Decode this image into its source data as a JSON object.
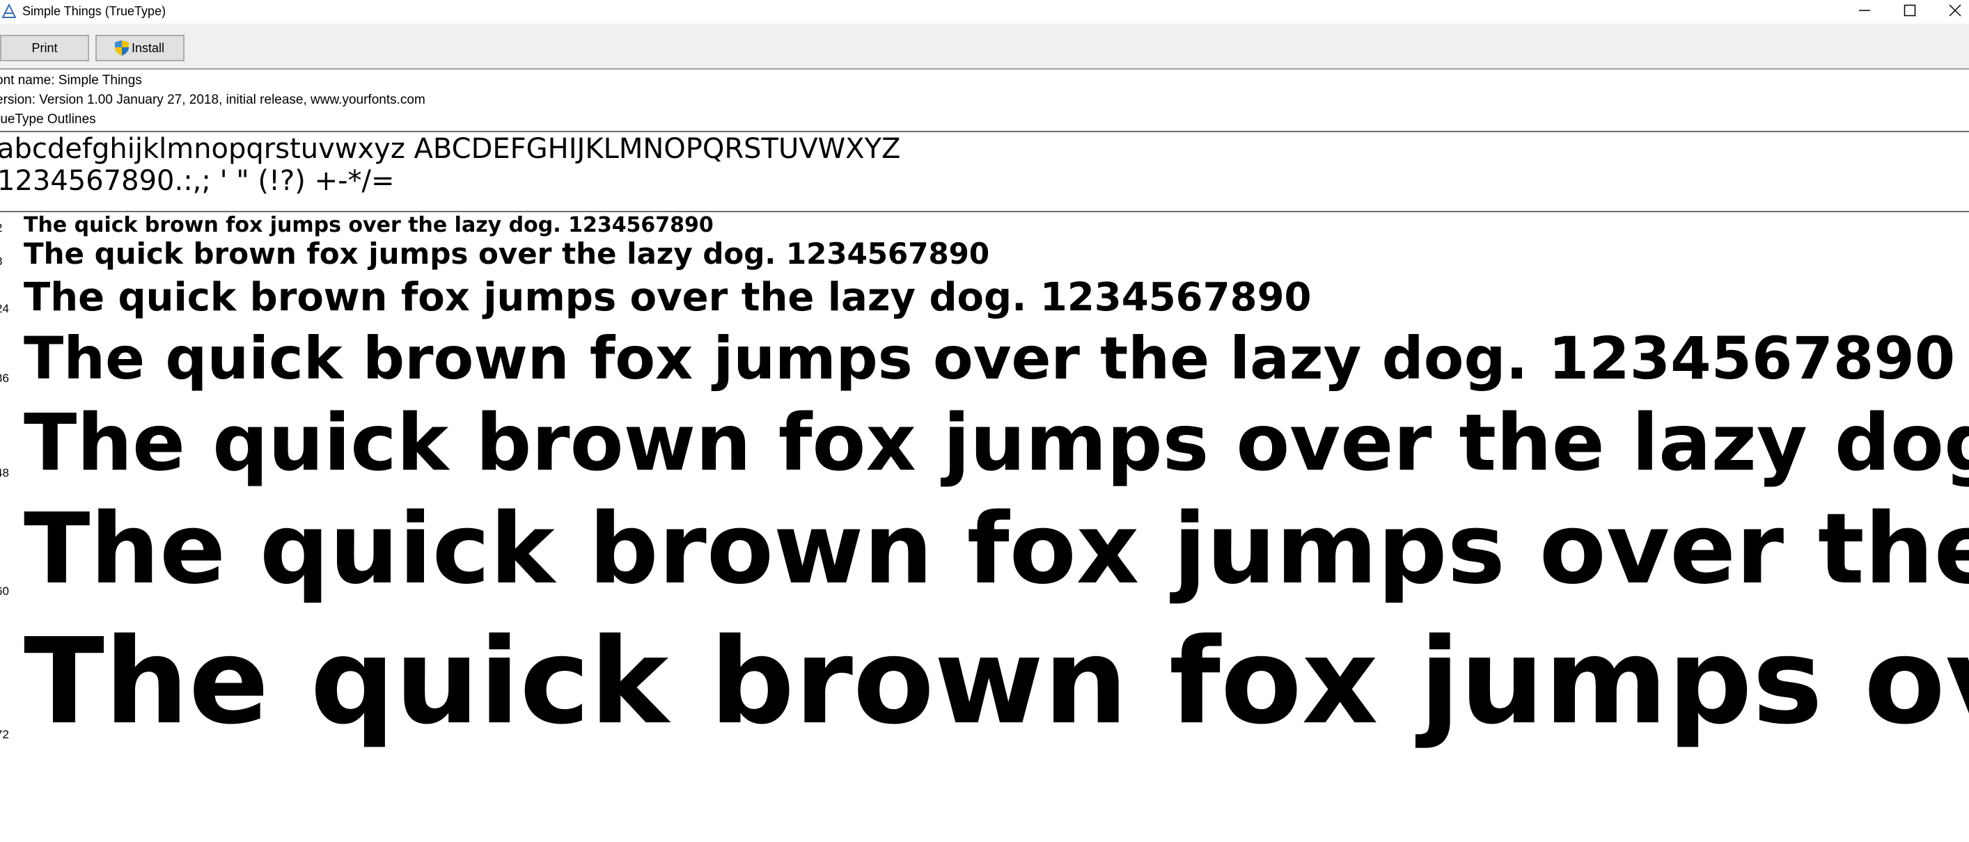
{
  "window": {
    "title": "Simple Things (TrueType)"
  },
  "toolbar": {
    "print_label": "Print",
    "install_label": "Install"
  },
  "info": {
    "font_name": "ont name: Simple Things",
    "version": "ersion: Version 1.00 January 27, 2018, initial release, www.yourfonts.com",
    "outlines": "rueType Outlines"
  },
  "charset": {
    "line1": "abcdefghijklmnopqrstuvwxyz ABCDEFGHIJKLMNOPQRSTUVWXYZ",
    "line2": "1234567890.:,; ' \" (!?) +-*/="
  },
  "samples": [
    {
      "size": "2",
      "text": "The quick brown fox jumps over the lazy dog. 1234567890"
    },
    {
      "size": "8",
      "text": "The quick brown fox jumps over the lazy dog. 1234567890"
    },
    {
      "size": "24",
      "text": "The quick brown fox jumps over the lazy dog. 1234567890"
    },
    {
      "size": "36",
      "text": "The quick brown fox jumps over the lazy dog. 1234567890"
    },
    {
      "size": "48",
      "text": "The quick brown fox jumps over the lazy dog"
    },
    {
      "size": "60",
      "text": "The quick brown fox jumps over the"
    },
    {
      "size": "72",
      "text": "The quick brown fox jumps ov"
    }
  ],
  "icons": {
    "app": "font-viewer-icon",
    "install": "uac-shield-icon",
    "minimize": "minimize-icon",
    "maximize": "maximize-icon",
    "close": "close-icon"
  },
  "colors": {
    "toolbar_bg": "#f0f0f0",
    "button_bg": "#e1e1e1",
    "button_border": "#adadad",
    "shield_blue": "#1e73be",
    "shield_yellow": "#f2c200"
  }
}
